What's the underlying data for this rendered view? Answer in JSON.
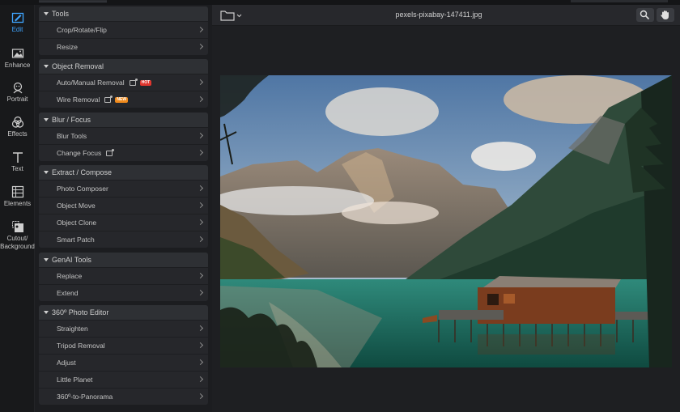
{
  "rail": {
    "items": [
      {
        "label": "Edit",
        "icon": "edit-icon"
      },
      {
        "label": "Enhance",
        "icon": "enhance-icon"
      },
      {
        "label": "Portrait",
        "icon": "portrait-icon"
      },
      {
        "label": "Effects",
        "icon": "effects-icon"
      },
      {
        "label": "Text",
        "icon": "text-icon"
      },
      {
        "label": "Elements",
        "icon": "elements-icon"
      },
      {
        "label": "Cutout/",
        "label2": "Background",
        "icon": "cutout-icon"
      }
    ],
    "active_color": "#3fa4ff"
  },
  "groups": [
    {
      "title": "Tools",
      "items": [
        {
          "label": "Crop/Rotate/Flip"
        },
        {
          "label": "Resize"
        }
      ]
    },
    {
      "title": "Object Removal",
      "items": [
        {
          "label": "Auto/Manual Removal",
          "badge": "HOT"
        },
        {
          "label": "Wire Removal",
          "badge": "NEW"
        }
      ]
    },
    {
      "title": "Blur / Focus",
      "items": [
        {
          "label": "Blur Tools"
        },
        {
          "label": "Change Focus"
        }
      ]
    },
    {
      "title": "Extract / Compose",
      "items": [
        {
          "label": "Photo Composer"
        },
        {
          "label": "Object Move"
        },
        {
          "label": "Object Clone"
        },
        {
          "label": "Smart Patch"
        }
      ]
    },
    {
      "title": "GenAI Tools",
      "items": [
        {
          "label": "Replace"
        },
        {
          "label": "Extend"
        }
      ]
    },
    {
      "title": "360º Photo Editor",
      "items": [
        {
          "label": "Straighten"
        },
        {
          "label": "Tripod Removal"
        },
        {
          "label": "Adjust"
        },
        {
          "label": "Little Planet"
        },
        {
          "label": "360º-to-Panorama"
        }
      ]
    }
  ],
  "toolbar": {
    "filename": "pexels-pixabay-147411.jpg",
    "icons": [
      "folder-icon",
      "zoom-icon",
      "hand-icon"
    ]
  },
  "image": {
    "subject": "mountain-lake-with-boathouse",
    "colors": {
      "sky": "#6f93b8",
      "water": "#1f6a5d",
      "cabin": "#8b4a2b"
    }
  }
}
